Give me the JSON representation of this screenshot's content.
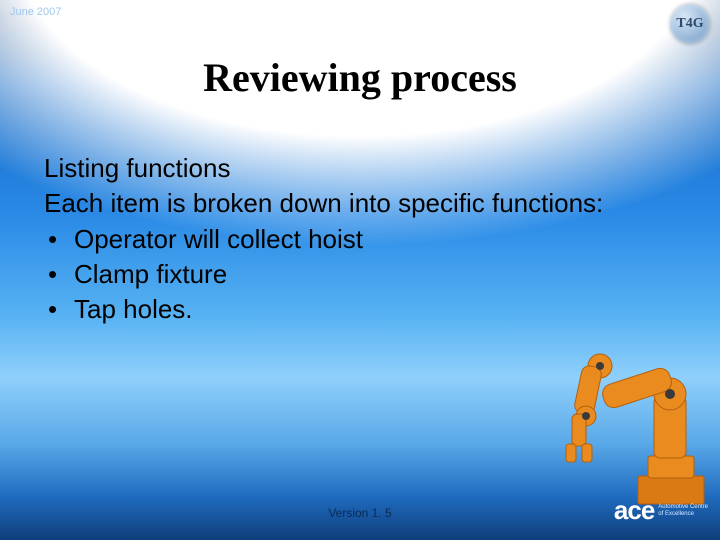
{
  "header": {
    "date": "June 2007",
    "top_logo_text": "T4G"
  },
  "title": "Reviewing process",
  "body": {
    "subtitle": "Listing functions",
    "lead": "Each item is broken down into specific functions:",
    "bullets": [
      "Operator will collect hoist",
      "Clamp fixture",
      "Tap holes."
    ]
  },
  "footer": {
    "version": "Version 1. 5",
    "logo_text": "ace",
    "logo_sub1": "Automotive Centre",
    "logo_sub2": "of Excellence"
  },
  "colors": {
    "accent_orange": "#e98b1f",
    "deep_blue": "#0f3e7a"
  }
}
